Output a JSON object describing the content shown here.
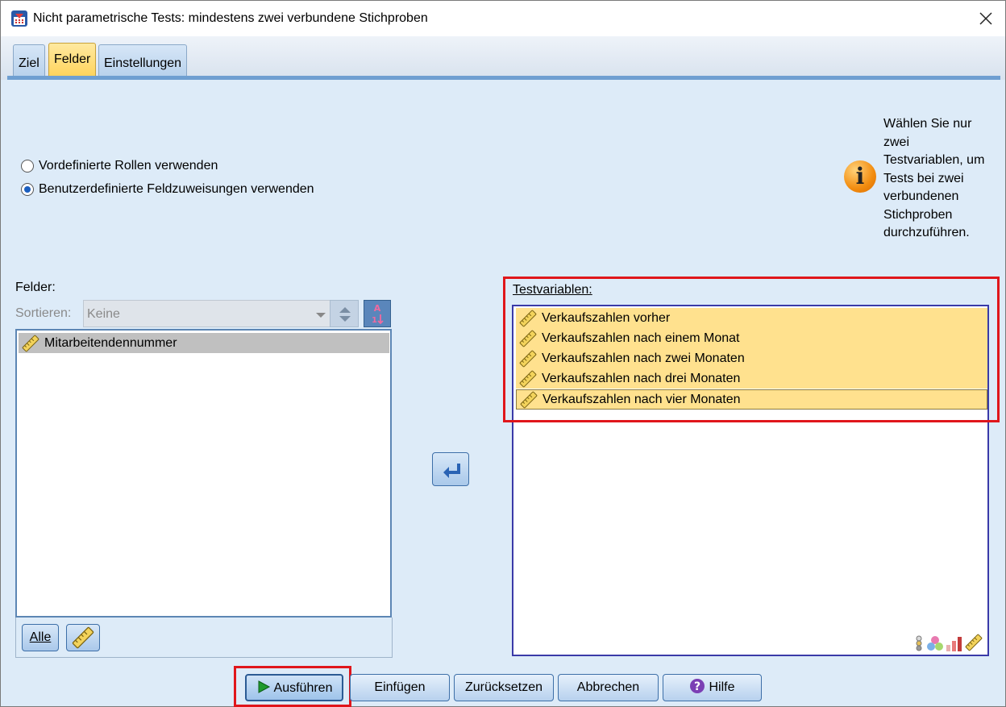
{
  "window": {
    "title": "Nicht parametrische Tests: mindestens zwei verbundene Stichproben"
  },
  "tabs": [
    {
      "label": "Ziel"
    },
    {
      "label": "Felder"
    },
    {
      "label": "Einstellungen"
    }
  ],
  "options": {
    "radio_predefined": "Vordefinierte Rollen verwenden",
    "radio_custom": "Benutzerdefinierte Feldzuweisungen verwenden",
    "selected": "custom"
  },
  "info": {
    "lines": [
      "Wählen Sie nur",
      "zwei",
      "Testvariablen, um",
      "Tests bei zwei",
      "verbundenen",
      "Stichproben",
      "durchzuführen."
    ]
  },
  "fields": {
    "label": "Felder:",
    "sort_label": "Sortieren:",
    "sort_value": "Keine",
    "items": [
      "Mitarbeitendennummer"
    ],
    "all_button": "Alle"
  },
  "test_variables": {
    "label": "Testvariablen:",
    "items": [
      "Verkaufszahlen vorher",
      "Verkaufszahlen nach einem Monat",
      "Verkaufszahlen nach zwei Monaten",
      "Verkaufszahlen nach drei Monaten",
      "Verkaufszahlen nach vier Monaten"
    ]
  },
  "buttons": {
    "run": "Ausführen",
    "paste": "Einfügen",
    "reset": "Zurücksetzen",
    "cancel": "Abbrechen",
    "help": "Hilfe"
  },
  "colors": {
    "highlight": "#ffe18e",
    "annotation": "#e0161b",
    "dialog_bg": "#ddebf8"
  }
}
